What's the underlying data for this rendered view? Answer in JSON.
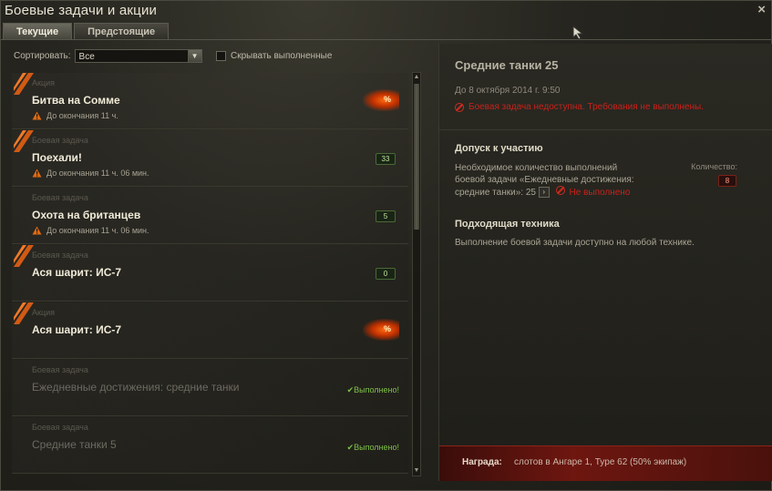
{
  "window": {
    "title": "Боевые задачи и акции",
    "close": "×"
  },
  "tabs": [
    {
      "label": "Текущие",
      "active": true
    },
    {
      "label": "Предстоящие",
      "active": false
    }
  ],
  "sort": {
    "label": "Сортировать:",
    "value": "Все",
    "hide_completed": "Скрывать выполненные"
  },
  "list": [
    {
      "kind": "Акция",
      "name": "Битва на Сомме",
      "warning": "До окончания 11 ч.",
      "indicator": "%",
      "style": "promo"
    },
    {
      "kind": "Боевая задача",
      "name": "Поехали!",
      "warning": "До окончания 11 ч. 06 мин.",
      "indicator": "33",
      "style": "badge"
    },
    {
      "kind": "Боевая задача",
      "name": "Охота на британцев",
      "warning": "До окончания 11 ч. 06 мин.",
      "indicator": "5",
      "style": "badge"
    },
    {
      "kind": "Боевая задача",
      "name": "Ася шарит: ИС-7",
      "warning": "",
      "indicator": "0",
      "style": "badge"
    },
    {
      "kind": "Акция",
      "name": "Ася шарит: ИС-7",
      "warning": "",
      "indicator": "%",
      "style": "promo"
    },
    {
      "kind": "Боевая задача",
      "name": "Ежедневные достижения: средние танки",
      "warning": "",
      "indicator": "✔Выполнено!",
      "style": "done"
    },
    {
      "kind": "Боевая задача",
      "name": "Средние танки 5",
      "warning": "",
      "indicator": "✔Выполнено!",
      "style": "done"
    }
  ],
  "details": {
    "title": "Средние танки 25",
    "date": "До 8 октября 2014 г. 9:50",
    "error": "Боевая задача недоступна. Требования не выполнены.",
    "admission_heading": "Допуск к участию",
    "req_line1": "Необходимое количество выполнений",
    "req_line2": "боевой задачи «Ежедневные достижения:",
    "req_line3": "средние танки»: 25",
    "req_button": "›",
    "req_status": "Не выполнено",
    "count_label": "Количество:",
    "count_value": "8",
    "vehicles_heading": "Подходящая техника",
    "vehicles_text": "Выполнение боевой задачи доступно на любой технике.",
    "reward_label": "Награда:",
    "reward_value": "слотов в Ангаре 1, Type 62 (50% экипаж)"
  },
  "colors": {
    "promo_glow": "#ff6a10",
    "error": "#c8221a",
    "done": "#7fc04a",
    "reward_bg": "#6e1610"
  }
}
